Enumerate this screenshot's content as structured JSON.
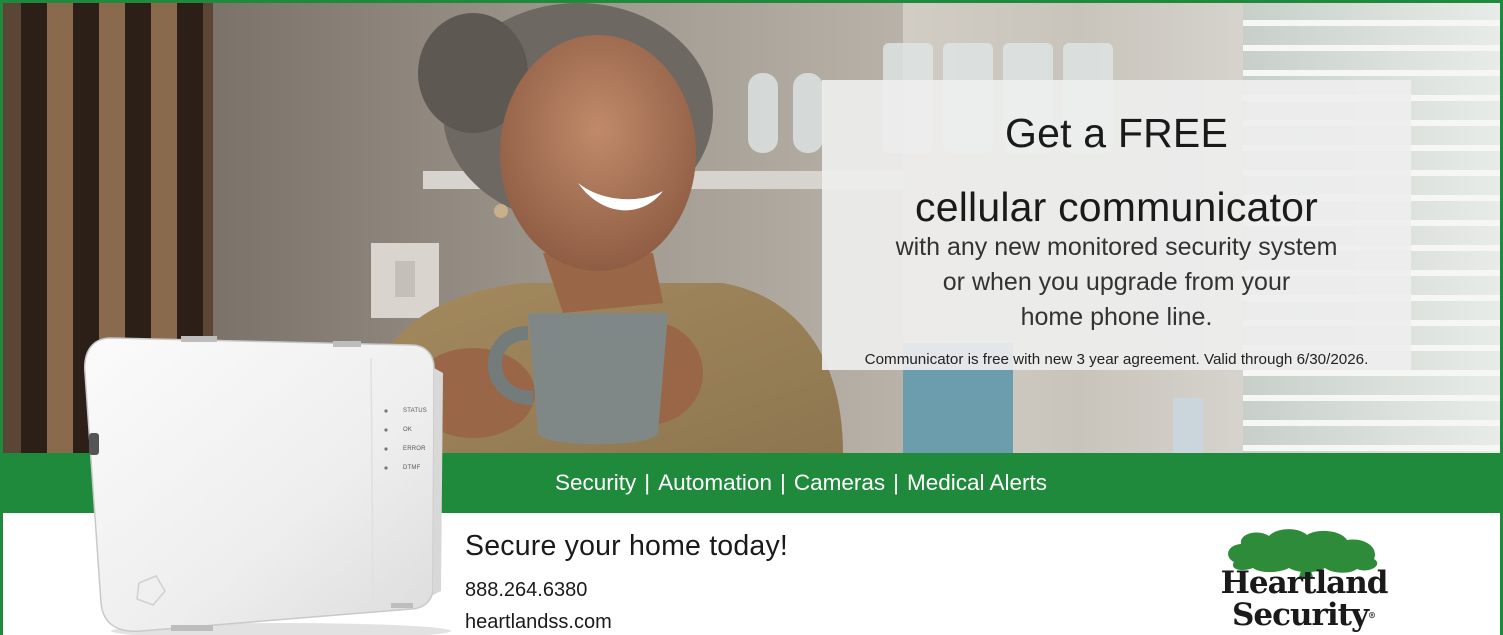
{
  "offer": {
    "headline_line1": "Get a FREE",
    "headline_line2": "cellular communicator",
    "body_line1": "with any new monitored security system",
    "body_line2": "or when you upgrade from your",
    "body_line3": "home phone line.",
    "fine_print": "Communicator is free with new 3 year agreement. Valid through 6/30/2026."
  },
  "band": {
    "services": [
      "Security",
      "Automation",
      "Cameras",
      "Medical Alerts"
    ],
    "separator": "|"
  },
  "contact": {
    "tagline": "Secure your home today!",
    "phone": "888.264.6380",
    "website": "heartlandss.com"
  },
  "device": {
    "leds": [
      "STATUS",
      "OK",
      "ERROR",
      "DTMF"
    ]
  },
  "logo": {
    "line1": "Heartland",
    "line2": "Security",
    "registered": "®"
  },
  "colors": {
    "brand_green": "#1f8a3c",
    "tree_green": "#2e8b3a",
    "offer_panel": "#eeeeee",
    "text_dark": "#1a1a1a"
  },
  "icons": {
    "logo_tree": "oak-tree-icon"
  }
}
